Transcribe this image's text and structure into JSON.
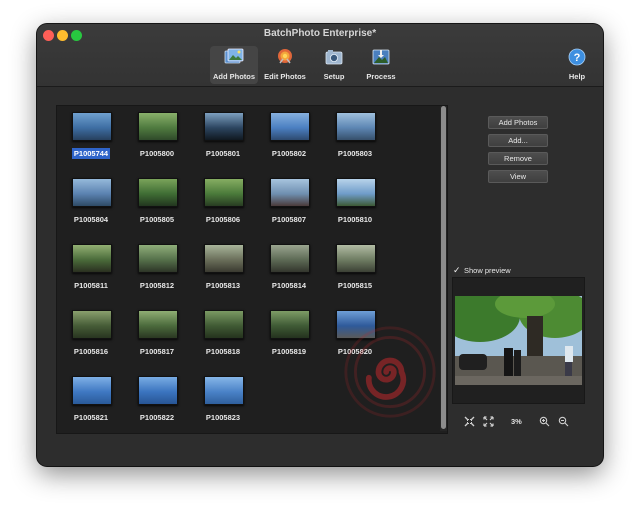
{
  "window": {
    "title": "BatchPhoto Enterprise*"
  },
  "toolbar": {
    "add_photos": "Add Photos",
    "edit_photos": "Edit Photos",
    "setup": "Setup",
    "process": "Process",
    "help": "Help"
  },
  "photos": [
    "P1005744",
    "P1005800",
    "P1005801",
    "P1005802",
    "P1005803",
    "P1005804",
    "P1005805",
    "P1005806",
    "P1005807",
    "P1005810",
    "P1005811",
    "P1005812",
    "P1005813",
    "P1005814",
    "P1005815",
    "P1005816",
    "P1005817",
    "P1005818",
    "P1005819",
    "P1005820",
    "P1005821",
    "P1005822",
    "P1005823"
  ],
  "selected_photo": "P1005744",
  "buttons": {
    "add_photos": "Add Photos",
    "add": "Add...",
    "remove": "Remove",
    "view": "View"
  },
  "preview": {
    "show_label": "Show preview",
    "checked": true,
    "check_glyph": "✓",
    "zoom": "3%"
  },
  "icons": {
    "fit": "fit-to-window-icon",
    "actual": "actual-size-icon",
    "zoom_in": "zoom-in-icon",
    "zoom_out": "zoom-out-icon"
  },
  "colors": {
    "window_bg": "#2d2d2d",
    "panel_bg": "#1f1f1f",
    "selection": "#2f64c9",
    "watermark": "#c0282c"
  }
}
